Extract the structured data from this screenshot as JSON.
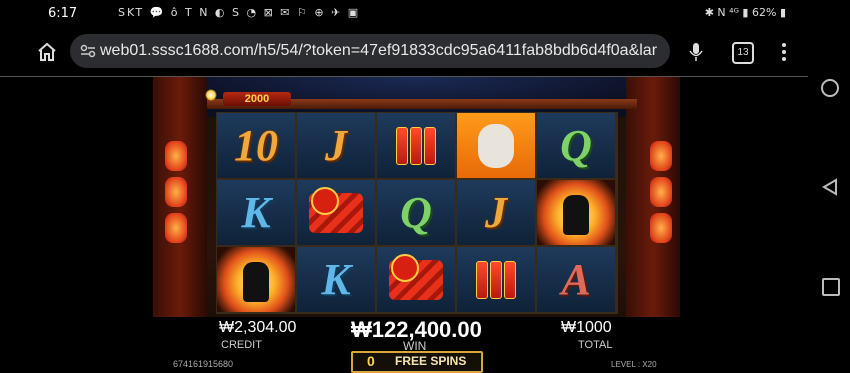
{
  "status_bar": {
    "time": "6:17",
    "carrier": "SKT",
    "left_icons": "💬 ô T N ◐ S ◔ ⊠ ✉ ⚐ ⊕ ✈ ▣",
    "right_icons": "✱ N ⁴ᴳ ▮",
    "battery": "62%"
  },
  "browser": {
    "url": "web01.sssc1688.com/h5/54/?token=47ef91833cdc95a6411fab8bdb6d4f0a&lar",
    "tab_count": "13"
  },
  "game": {
    "jackpot_bar": "2000",
    "reels": [
      [
        {
          "label": "10",
          "style": "gold"
        },
        {
          "label": "K",
          "style": "blue"
        },
        {
          "label": "",
          "style": "fire"
        }
      ],
      [
        {
          "label": "J",
          "style": "gold"
        },
        {
          "label": "",
          "style": "bundle"
        },
        {
          "label": "K",
          "style": "blue"
        }
      ],
      [
        {
          "label": "",
          "style": "crackers"
        },
        {
          "label": "Q",
          "style": "green"
        },
        {
          "label": "",
          "style": "bundle"
        }
      ],
      [
        {
          "label": "",
          "style": "llama"
        },
        {
          "label": "J",
          "style": "gold"
        },
        {
          "label": "",
          "style": "crackers"
        }
      ],
      [
        {
          "label": "Q",
          "style": "green"
        },
        {
          "label": "",
          "style": "fire"
        },
        {
          "label": "A",
          "style": "red"
        }
      ]
    ],
    "credit_value": "₩2,304.00",
    "credit_label": "CREDIT",
    "win_value": "₩122,400.00",
    "win_label": "WIN",
    "total_value": "₩1000",
    "total_label": "TOTAL",
    "free_spins_count": "0",
    "free_spins_label": "FREE SPINS",
    "ticket_id": "674161915680",
    "level_text": "LEVEL : X20"
  }
}
